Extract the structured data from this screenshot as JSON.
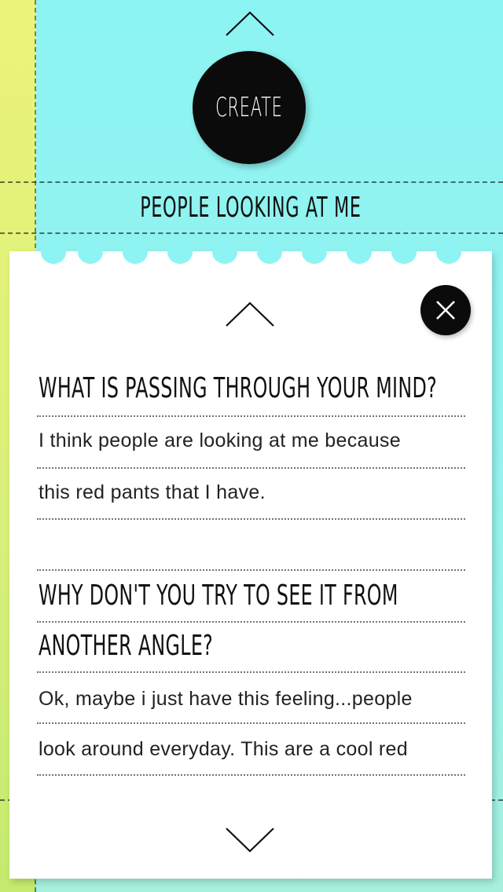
{
  "header": {
    "create_label": "CREATE",
    "thought_title": "PEOPLE LOOKING AT ME"
  },
  "card": {
    "question1": "WHAT IS PASSING THROUGH YOUR MIND?",
    "answer1_lines": [
      "I think people are looking at me because",
      "this red pants that I have."
    ],
    "question2_lines": [
      "WHY DON'T YOU TRY TO SEE IT FROM",
      "ANOTHER ANGLE?"
    ],
    "answer2_lines": [
      "Ok, maybe i just have this feeling...people",
      "look around everyday. This are a cool red"
    ]
  },
  "icons": {
    "up": "chevron-up-icon",
    "down": "chevron-down-icon",
    "close": "close-icon"
  },
  "colors": {
    "background": "#8ef3f4",
    "side_strip": "#e6f27a",
    "button": "#0b0b0b",
    "card": "#ffffff"
  }
}
